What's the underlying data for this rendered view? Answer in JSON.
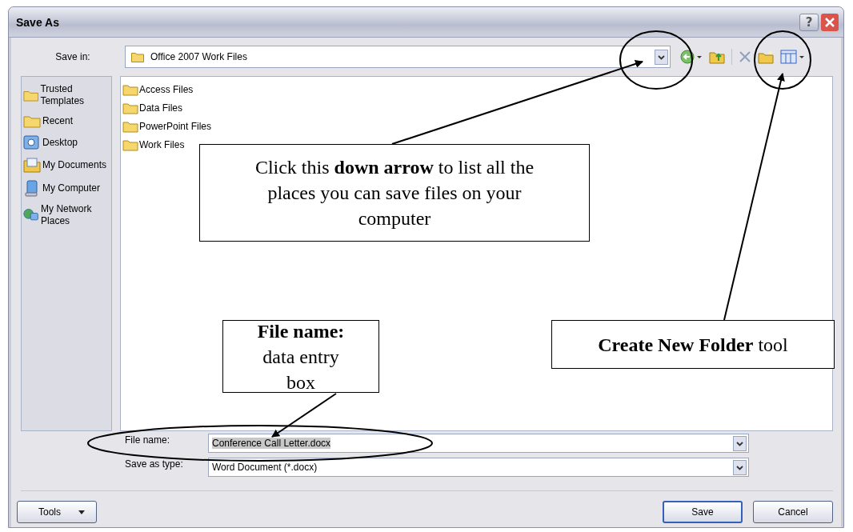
{
  "window": {
    "title": "Save As",
    "help": "?"
  },
  "save_in": {
    "label": "Save in:",
    "value": "Office 2007 Work Files"
  },
  "sidebar": {
    "items": [
      {
        "label": "Trusted Templates",
        "kind": "folder"
      },
      {
        "label": "Recent",
        "kind": "folder"
      },
      {
        "label": "Desktop",
        "kind": "desktop"
      },
      {
        "label": "My Documents",
        "kind": "documents"
      },
      {
        "label": "My Computer",
        "kind": "computer"
      },
      {
        "label": "My Network Places",
        "kind": "network"
      }
    ]
  },
  "files": [
    "Access Files",
    "Data Files",
    "PowerPoint Files",
    "Work Files"
  ],
  "file_name": {
    "label": "File name:",
    "value": "Conference Call Letter.docx"
  },
  "save_as_type": {
    "label": "Save as type:",
    "value": "Word Document (*.docx)"
  },
  "buttons": {
    "tools": "Tools",
    "save": "Save",
    "cancel": "Cancel"
  },
  "annotations": [
    {
      "kind": "dropdown",
      "text": "Click this **down arrow** to list all the places you can save files on your computer"
    },
    {
      "kind": "filename",
      "text": "**File name:** data entry box"
    },
    {
      "kind": "newfolder",
      "text": "**Create New Folder** tool"
    }
  ]
}
